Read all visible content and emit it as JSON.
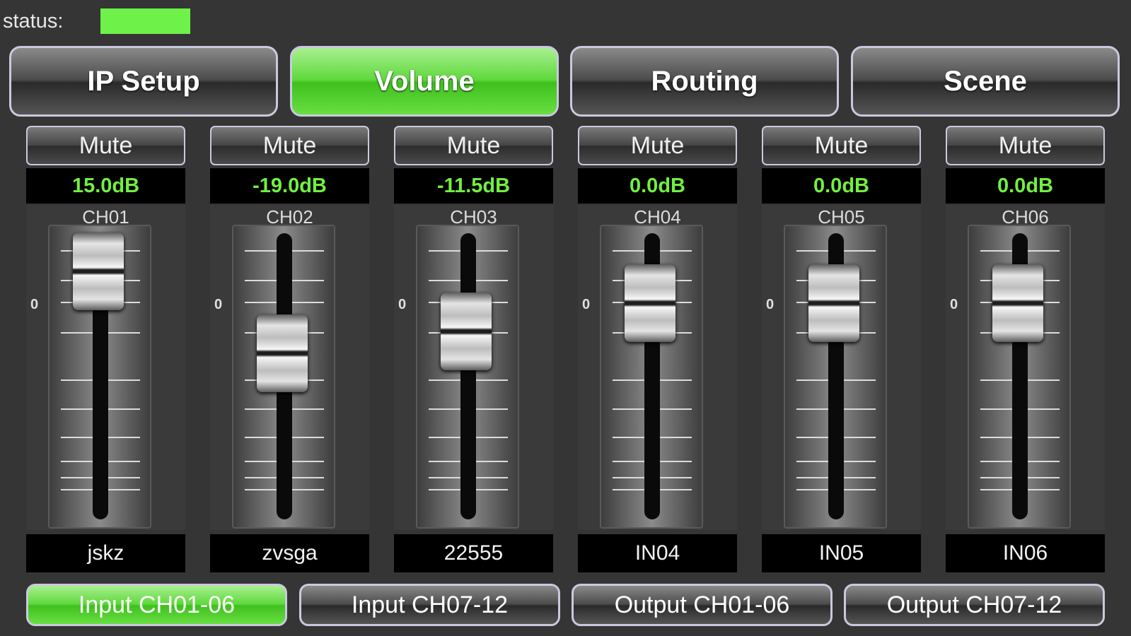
{
  "status": {
    "label": "status:",
    "indicator_color": "#6ef24a"
  },
  "tabs": [
    {
      "label": "IP Setup",
      "active": false
    },
    {
      "label": "Volume",
      "active": true
    },
    {
      "label": "Routing",
      "active": false
    },
    {
      "label": "Scene",
      "active": false
    }
  ],
  "zero_mark": "0",
  "mute_label": "Mute",
  "channels": [
    {
      "id": "CH01",
      "db": "15.0dB",
      "name": "jskz"
    },
    {
      "id": "CH02",
      "db": "-19.0dB",
      "name": "zvsga"
    },
    {
      "id": "CH03",
      "db": "-11.5dB",
      "name": "22555"
    },
    {
      "id": "CH04",
      "db": "0.0dB",
      "name": "IN04"
    },
    {
      "id": "CH05",
      "db": "0.0dB",
      "name": "IN05"
    },
    {
      "id": "CH06",
      "db": "0.0dB",
      "name": "IN06"
    }
  ],
  "pages": [
    {
      "label": "Input CH01-06",
      "active": true
    },
    {
      "label": "Input CH07-12",
      "active": false
    },
    {
      "label": "Output CH01-06",
      "active": false
    },
    {
      "label": "Output CH07-12",
      "active": false
    }
  ],
  "colors": {
    "accent": "#5fd83c",
    "db_text": "#72f03f"
  }
}
